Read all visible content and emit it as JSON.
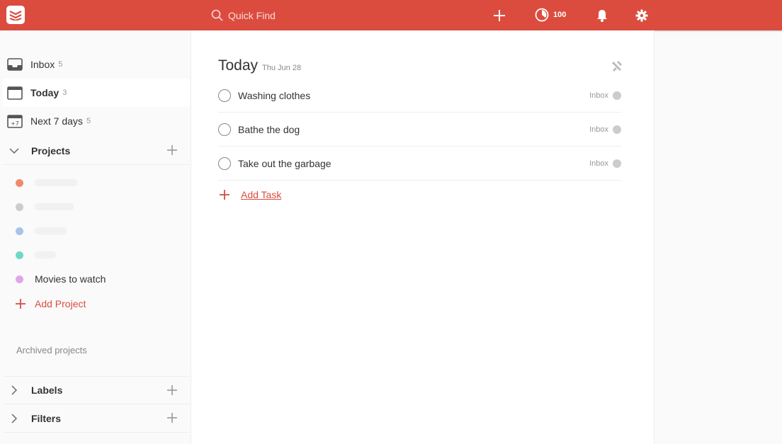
{
  "topbar": {
    "search_placeholder": "Quick Find",
    "karma_value": "100"
  },
  "sidebar": {
    "nav": [
      {
        "label": "Inbox",
        "count": "5"
      },
      {
        "label": "Today",
        "count": "3"
      },
      {
        "label": "Next 7 days",
        "count": "5"
      }
    ],
    "projects_label": "Projects",
    "projects": [
      {
        "name": "",
        "color": "#f08a6d"
      },
      {
        "name": "",
        "color": "#cccccc"
      },
      {
        "name": "",
        "color": "#a8c4e6"
      },
      {
        "name": "",
        "color": "#6fd8c4"
      },
      {
        "name": "Movies to watch",
        "color": "#e1a6e5"
      }
    ],
    "add_project_label": "Add Project",
    "archived_label": "Archived projects",
    "labels_label": "Labels",
    "filters_label": "Filters"
  },
  "main": {
    "title": "Today",
    "date": "Thu Jun 28",
    "tasks": [
      {
        "text": "Washing clothes",
        "project": "Inbox"
      },
      {
        "text": "Bathe the dog",
        "project": "Inbox"
      },
      {
        "text": "Take out the garbage",
        "project": "Inbox"
      }
    ],
    "add_task_label": "Add Task"
  },
  "colors": {
    "brand": "#db4c3f"
  }
}
